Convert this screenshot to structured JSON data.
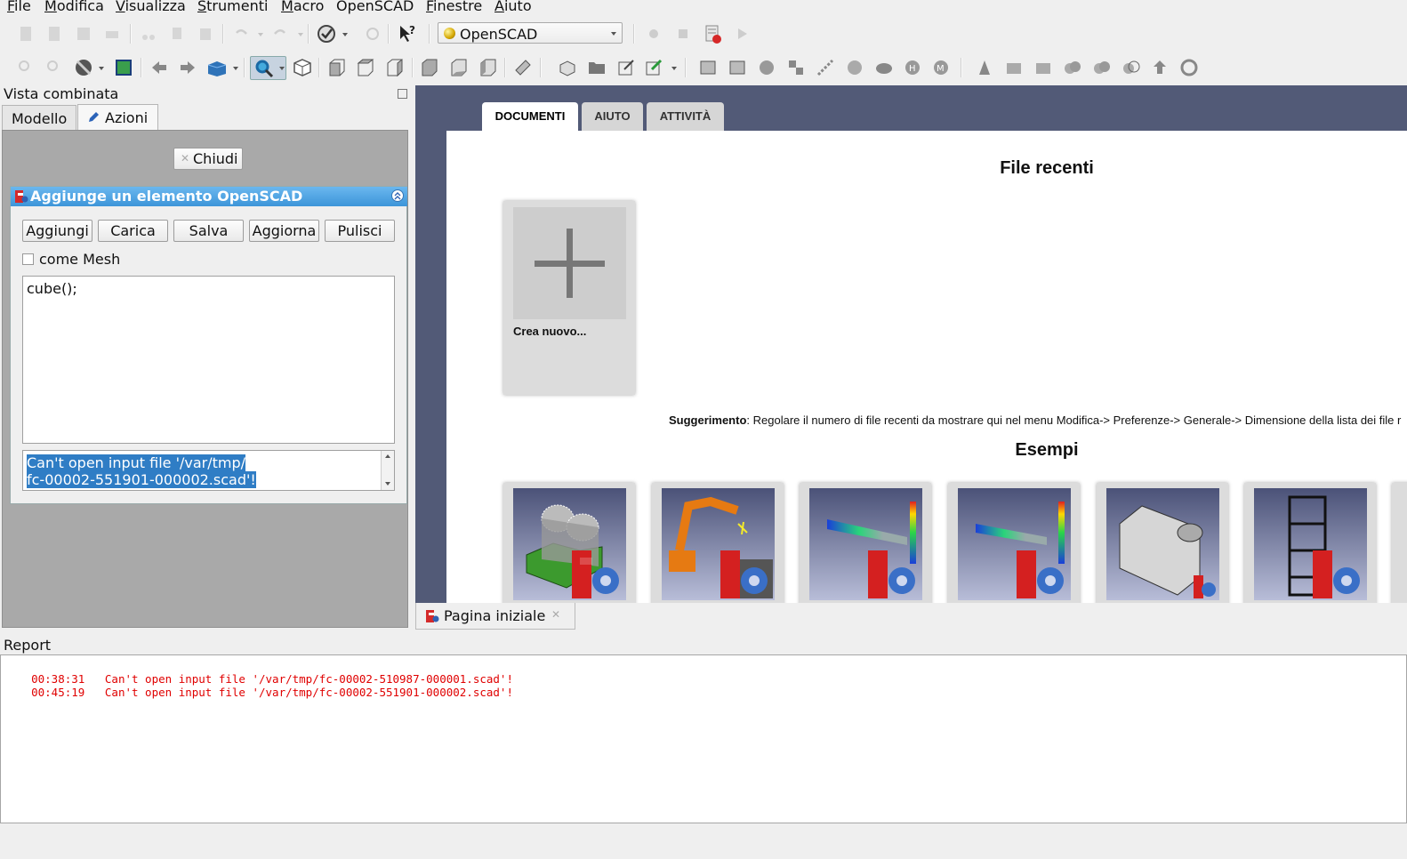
{
  "menu": [
    "File",
    "Modifica",
    "Visualizza",
    "Strumenti",
    "Macro",
    "OpenSCAD",
    "Finestre",
    "Aiuto"
  ],
  "menu_mnemonics": [
    "F",
    "M",
    "V",
    "S",
    "M",
    "",
    "F",
    "A"
  ],
  "toolbar": {
    "workbench": "OpenSCAD"
  },
  "combo_view": {
    "title": "Vista combinata",
    "tabs": [
      "Modello",
      "Azioni"
    ],
    "active_tab": "Azioni",
    "close_button": "Chiudi",
    "panel_title": "Aggiunge un elemento OpenSCAD",
    "buttons": [
      "Aggiungi",
      "Carica",
      "Salva",
      "Aggiorna",
      "Pulisci"
    ],
    "mesh_checkbox": "come Mesh",
    "mesh_checked": false,
    "code": "cube();",
    "message_line1": "Can't open input file '/var/tmp/",
    "message_line2": "fc-00002-551901-000002.scad'!"
  },
  "start_page": {
    "tabs": [
      "DOCUMENTI",
      "AIUTO",
      "ATTIVITÀ"
    ],
    "active_tab": "DOCUMENTI",
    "recent_title": "File recenti",
    "new_file_label": "Crea nuovo...",
    "tip_bold": "Suggerimento",
    "tip_text": ": Regolare il numero di file recenti da mostrare qui nel menu Modifica-> Preferenze-> Generale-> Dimensione della lista dei file r",
    "examples_title": "Esempi",
    "examples_count": 6
  },
  "document_tab": {
    "label": "Pagina iniziale"
  },
  "report": {
    "title": "Report",
    "lines": [
      {
        "time": "00:38:31",
        "text": "Can't open input file '/var/tmp/fc-00002-510987-000001.scad'!"
      },
      {
        "time": "00:45:19",
        "text": "Can't open input file '/var/tmp/fc-00002-551901-000002.scad'!"
      }
    ],
    "error_color": "#e00000"
  },
  "colors": {
    "header_blue": "#3d95d9",
    "selection": "#2f7dc5",
    "view_background": "#525a77"
  }
}
